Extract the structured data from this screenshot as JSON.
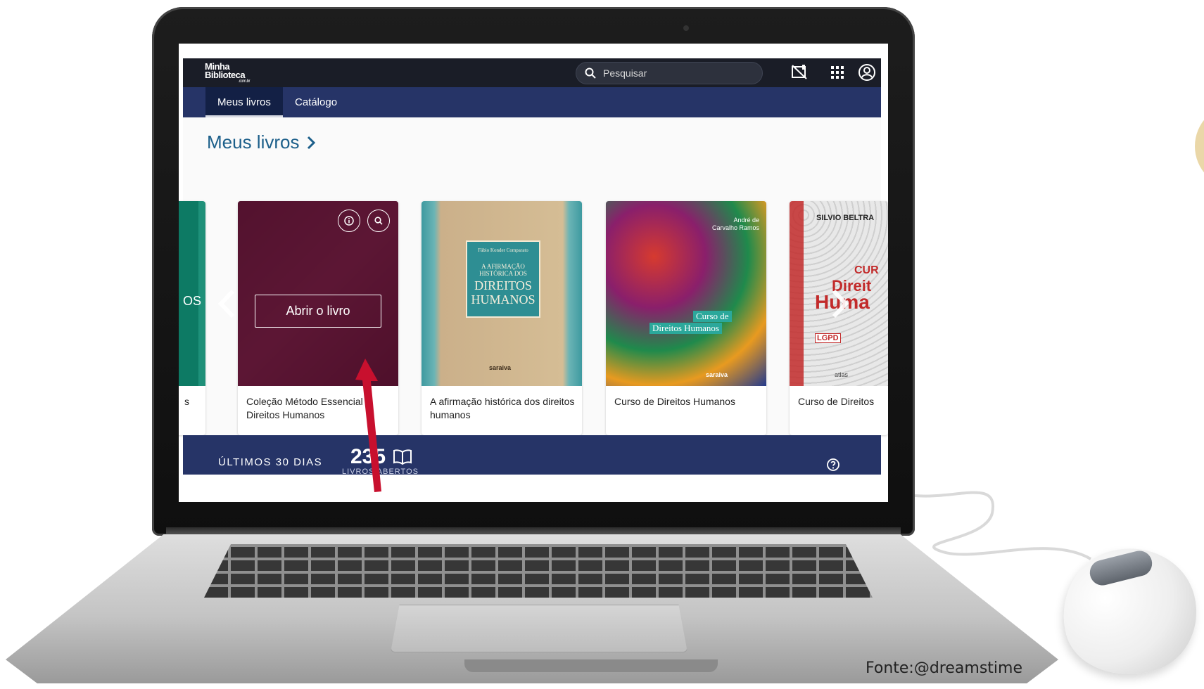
{
  "app": {
    "logo_line1": "Minha",
    "logo_line2": "Biblioteca",
    "logo_sub": ".com.br"
  },
  "topbar": {
    "search_placeholder": "Pesquisar",
    "icons": [
      "search-icon",
      "no-connection-icon",
      "apps-grid-icon",
      "account-icon"
    ]
  },
  "nav": {
    "tabs": [
      {
        "label": "Meus livros",
        "active": true
      },
      {
        "label": "Catálogo",
        "active": false
      }
    ]
  },
  "section": {
    "title": "Meus livros"
  },
  "books": [
    {
      "title": "s",
      "cover_text": "OS"
    },
    {
      "title": "Coleção Método Essencial - Direitos Humanos",
      "open_label": "Abrir o livro"
    },
    {
      "title": "A afirmação histórica dos direitos humanos",
      "cover_author": "Fábio Konder Comparato",
      "cover_line1": "A AFIRMAÇÃO",
      "cover_line2": "HISTÓRICA DOS",
      "cover_line3": "DIREITOS",
      "cover_line4": "HUMANOS",
      "cover_publisher": "saraiva"
    },
    {
      "title": "Curso de Direitos Humanos",
      "cover_author": "André de Carvalho Ramos",
      "cover_line1": "Curso de",
      "cover_line2": "Direitos Humanos",
      "cover_publisher": "saraiva"
    },
    {
      "title": "Curso de Direitos",
      "cover_author": "SILVIO BELTRA",
      "cover_line1": "CUR",
      "cover_line2": "Direit",
      "cover_line3": "Huma",
      "cover_badge": "LGPD",
      "cover_publisher": "atlas"
    }
  ],
  "stats": {
    "label": "ÚLTIMOS 30 DIAS",
    "value": "235",
    "sublabel": "LIVROS ABERTOS"
  },
  "credit": "Fonte:@dreamstime",
  "colors": {
    "topbar": "#1a1d27",
    "navbar": "#263467",
    "accent_title": "#1c5f8a",
    "arrow": "#c8102e"
  }
}
